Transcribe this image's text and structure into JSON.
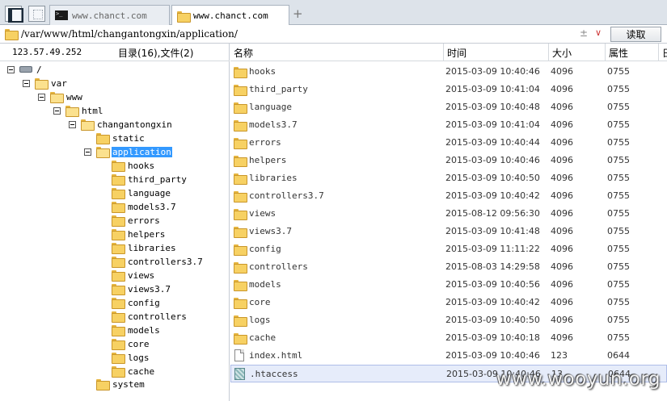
{
  "tabs": [
    {
      "label": "www.chanct.com",
      "active": false
    },
    {
      "label": "www.chanct.com",
      "active": true
    }
  ],
  "address": {
    "path": "/var/www/html/changantongxin/application/",
    "plus_glyph": "±",
    "dropdown_glyph": "∨",
    "read_label": "读取"
  },
  "left_panel": {
    "ip": "123.57.49.252",
    "counts": "目录(16),文件(2)"
  },
  "tree": {
    "root": "/",
    "var": "var",
    "www": "www",
    "html": "html",
    "project": "changantongxin",
    "static": "static",
    "application": "application",
    "children": [
      "hooks",
      "third_party",
      "language",
      "models3.7",
      "errors",
      "helpers",
      "libraries",
      "controllers3.7",
      "views",
      "views3.7",
      "config",
      "controllers",
      "models",
      "core",
      "logs",
      "cache"
    ],
    "system": "system"
  },
  "columns": {
    "name": "名称",
    "time": "时间",
    "size": "大小",
    "attr": "属性",
    "extra": "日"
  },
  "files": [
    {
      "name": "hooks",
      "time": "2015-03-09 10:40:46",
      "size": "4096",
      "attr": "0755",
      "type": "folder"
    },
    {
      "name": "third_party",
      "time": "2015-03-09 10:41:04",
      "size": "4096",
      "attr": "0755",
      "type": "folder"
    },
    {
      "name": "language",
      "time": "2015-03-09 10:40:48",
      "size": "4096",
      "attr": "0755",
      "type": "folder"
    },
    {
      "name": "models3.7",
      "time": "2015-03-09 10:41:04",
      "size": "4096",
      "attr": "0755",
      "type": "folder"
    },
    {
      "name": "errors",
      "time": "2015-03-09 10:40:44",
      "size": "4096",
      "attr": "0755",
      "type": "folder"
    },
    {
      "name": "helpers",
      "time": "2015-03-09 10:40:46",
      "size": "4096",
      "attr": "0755",
      "type": "folder"
    },
    {
      "name": "libraries",
      "time": "2015-03-09 10:40:50",
      "size": "4096",
      "attr": "0755",
      "type": "folder"
    },
    {
      "name": "controllers3.7",
      "time": "2015-03-09 10:40:42",
      "size": "4096",
      "attr": "0755",
      "type": "folder"
    },
    {
      "name": "views",
      "time": "2015-08-12 09:56:30",
      "size": "4096",
      "attr": "0755",
      "type": "folder"
    },
    {
      "name": "views3.7",
      "time": "2015-03-09 10:41:48",
      "size": "4096",
      "attr": "0755",
      "type": "folder"
    },
    {
      "name": "config",
      "time": "2015-03-09 11:11:22",
      "size": "4096",
      "attr": "0755",
      "type": "folder"
    },
    {
      "name": "controllers",
      "time": "2015-08-03 14:29:58",
      "size": "4096",
      "attr": "0755",
      "type": "folder"
    },
    {
      "name": "models",
      "time": "2015-03-09 10:40:56",
      "size": "4096",
      "attr": "0755",
      "type": "folder"
    },
    {
      "name": "core",
      "time": "2015-03-09 10:40:42",
      "size": "4096",
      "attr": "0755",
      "type": "folder"
    },
    {
      "name": "logs",
      "time": "2015-03-09 10:40:50",
      "size": "4096",
      "attr": "0755",
      "type": "folder"
    },
    {
      "name": "cache",
      "time": "2015-03-09 10:40:18",
      "size": "4096",
      "attr": "0755",
      "type": "folder"
    },
    {
      "name": "index.html",
      "time": "2015-03-09 10:40:46",
      "size": "123",
      "attr": "0644",
      "type": "file"
    },
    {
      "name": ".htaccess",
      "time": "2015-03-09 10:40:46",
      "size": "13",
      "attr": "0644",
      "type": "htaccess"
    }
  ],
  "watermark": "www.wooyun.org",
  "colors": {
    "selection": "#3399ff",
    "folder": "#f7d163",
    "row_selected": "#e6ecfa"
  }
}
